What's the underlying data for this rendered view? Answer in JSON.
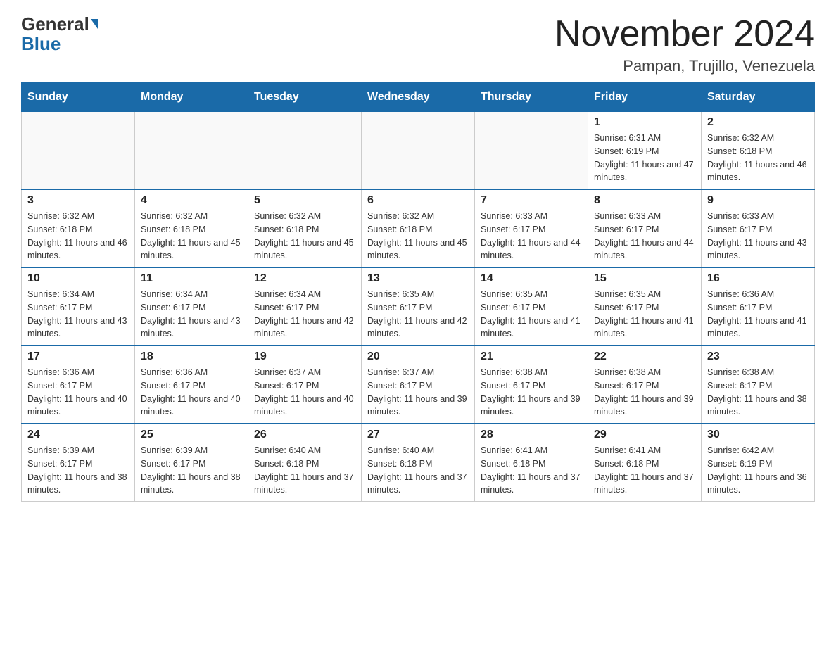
{
  "header": {
    "logo_general": "General",
    "logo_blue": "Blue",
    "month_title": "November 2024",
    "location": "Pampan, Trujillo, Venezuela"
  },
  "weekdays": [
    "Sunday",
    "Monday",
    "Tuesday",
    "Wednesday",
    "Thursday",
    "Friday",
    "Saturday"
  ],
  "weeks": [
    [
      {
        "day": "",
        "info": ""
      },
      {
        "day": "",
        "info": ""
      },
      {
        "day": "",
        "info": ""
      },
      {
        "day": "",
        "info": ""
      },
      {
        "day": "",
        "info": ""
      },
      {
        "day": "1",
        "info": "Sunrise: 6:31 AM\nSunset: 6:19 PM\nDaylight: 11 hours and 47 minutes."
      },
      {
        "day": "2",
        "info": "Sunrise: 6:32 AM\nSunset: 6:18 PM\nDaylight: 11 hours and 46 minutes."
      }
    ],
    [
      {
        "day": "3",
        "info": "Sunrise: 6:32 AM\nSunset: 6:18 PM\nDaylight: 11 hours and 46 minutes."
      },
      {
        "day": "4",
        "info": "Sunrise: 6:32 AM\nSunset: 6:18 PM\nDaylight: 11 hours and 45 minutes."
      },
      {
        "day": "5",
        "info": "Sunrise: 6:32 AM\nSunset: 6:18 PM\nDaylight: 11 hours and 45 minutes."
      },
      {
        "day": "6",
        "info": "Sunrise: 6:32 AM\nSunset: 6:18 PM\nDaylight: 11 hours and 45 minutes."
      },
      {
        "day": "7",
        "info": "Sunrise: 6:33 AM\nSunset: 6:17 PM\nDaylight: 11 hours and 44 minutes."
      },
      {
        "day": "8",
        "info": "Sunrise: 6:33 AM\nSunset: 6:17 PM\nDaylight: 11 hours and 44 minutes."
      },
      {
        "day": "9",
        "info": "Sunrise: 6:33 AM\nSunset: 6:17 PM\nDaylight: 11 hours and 43 minutes."
      }
    ],
    [
      {
        "day": "10",
        "info": "Sunrise: 6:34 AM\nSunset: 6:17 PM\nDaylight: 11 hours and 43 minutes."
      },
      {
        "day": "11",
        "info": "Sunrise: 6:34 AM\nSunset: 6:17 PM\nDaylight: 11 hours and 43 minutes."
      },
      {
        "day": "12",
        "info": "Sunrise: 6:34 AM\nSunset: 6:17 PM\nDaylight: 11 hours and 42 minutes."
      },
      {
        "day": "13",
        "info": "Sunrise: 6:35 AM\nSunset: 6:17 PM\nDaylight: 11 hours and 42 minutes."
      },
      {
        "day": "14",
        "info": "Sunrise: 6:35 AM\nSunset: 6:17 PM\nDaylight: 11 hours and 41 minutes."
      },
      {
        "day": "15",
        "info": "Sunrise: 6:35 AM\nSunset: 6:17 PM\nDaylight: 11 hours and 41 minutes."
      },
      {
        "day": "16",
        "info": "Sunrise: 6:36 AM\nSunset: 6:17 PM\nDaylight: 11 hours and 41 minutes."
      }
    ],
    [
      {
        "day": "17",
        "info": "Sunrise: 6:36 AM\nSunset: 6:17 PM\nDaylight: 11 hours and 40 minutes."
      },
      {
        "day": "18",
        "info": "Sunrise: 6:36 AM\nSunset: 6:17 PM\nDaylight: 11 hours and 40 minutes."
      },
      {
        "day": "19",
        "info": "Sunrise: 6:37 AM\nSunset: 6:17 PM\nDaylight: 11 hours and 40 minutes."
      },
      {
        "day": "20",
        "info": "Sunrise: 6:37 AM\nSunset: 6:17 PM\nDaylight: 11 hours and 39 minutes."
      },
      {
        "day": "21",
        "info": "Sunrise: 6:38 AM\nSunset: 6:17 PM\nDaylight: 11 hours and 39 minutes."
      },
      {
        "day": "22",
        "info": "Sunrise: 6:38 AM\nSunset: 6:17 PM\nDaylight: 11 hours and 39 minutes."
      },
      {
        "day": "23",
        "info": "Sunrise: 6:38 AM\nSunset: 6:17 PM\nDaylight: 11 hours and 38 minutes."
      }
    ],
    [
      {
        "day": "24",
        "info": "Sunrise: 6:39 AM\nSunset: 6:17 PM\nDaylight: 11 hours and 38 minutes."
      },
      {
        "day": "25",
        "info": "Sunrise: 6:39 AM\nSunset: 6:17 PM\nDaylight: 11 hours and 38 minutes."
      },
      {
        "day": "26",
        "info": "Sunrise: 6:40 AM\nSunset: 6:18 PM\nDaylight: 11 hours and 37 minutes."
      },
      {
        "day": "27",
        "info": "Sunrise: 6:40 AM\nSunset: 6:18 PM\nDaylight: 11 hours and 37 minutes."
      },
      {
        "day": "28",
        "info": "Sunrise: 6:41 AM\nSunset: 6:18 PM\nDaylight: 11 hours and 37 minutes."
      },
      {
        "day": "29",
        "info": "Sunrise: 6:41 AM\nSunset: 6:18 PM\nDaylight: 11 hours and 37 minutes."
      },
      {
        "day": "30",
        "info": "Sunrise: 6:42 AM\nSunset: 6:19 PM\nDaylight: 11 hours and 36 minutes."
      }
    ]
  ]
}
